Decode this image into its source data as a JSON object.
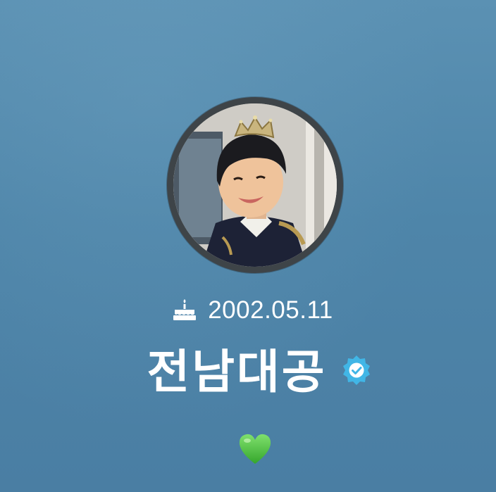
{
  "profile": {
    "photo_icon": "profile-photo-child-with-crown",
    "birthday_icon": "birthday-cake-icon",
    "birthday": "2002.05.11",
    "display_name": "전남대공",
    "verified_icon": "verified-badge-icon",
    "status_emoji": "green-heart-icon"
  },
  "colors": {
    "background": "#4e85a9",
    "ring": "#3e4448",
    "verified_badge": "#41b6e6",
    "heart": "#4cc340",
    "text": "#ffffff"
  }
}
